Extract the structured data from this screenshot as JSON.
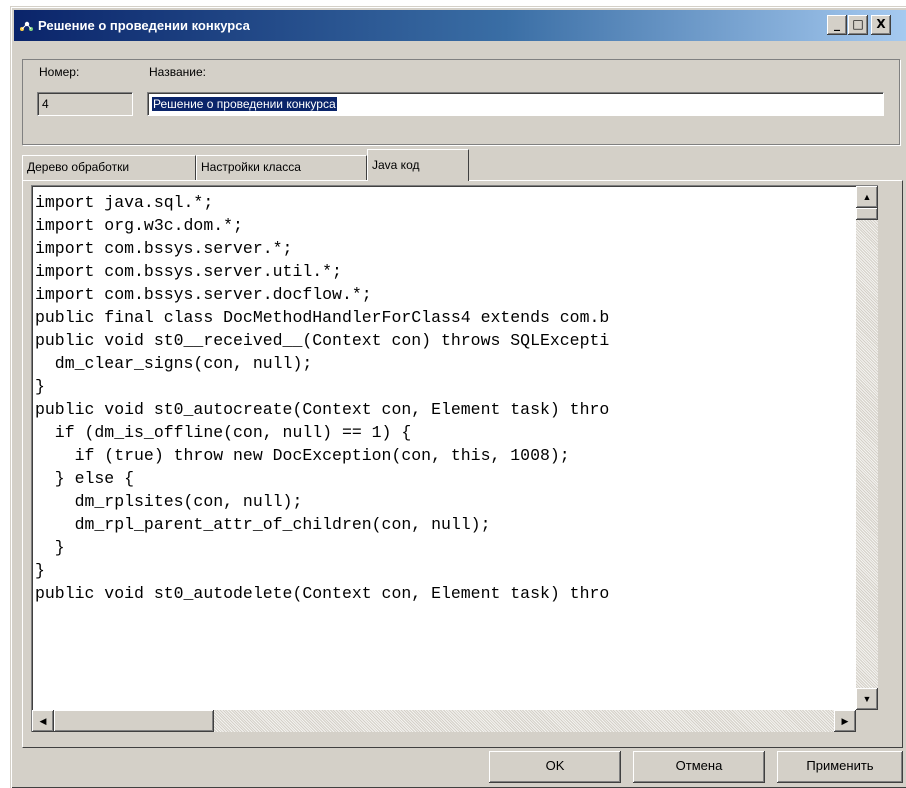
{
  "window": {
    "title": "Решение о проведении конкурса"
  },
  "title_buttons": {
    "minimize": "_",
    "maximize": "□",
    "close": "X"
  },
  "form": {
    "number_label": "Номер:",
    "number_value": "4",
    "name_label": "Название:",
    "name_value": "Решение о проведении конкурса"
  },
  "tabs": [
    {
      "label": "Дерево обработки",
      "active": false
    },
    {
      "label": "Настройки класса",
      "active": false
    },
    {
      "label": "Java код",
      "active": true
    }
  ],
  "code_lines": [
    "import java.sql.*;",
    "import org.w3c.dom.*;",
    "import com.bssys.server.*;",
    "import com.bssys.server.util.*;",
    "import com.bssys.server.docflow.*;",
    "public final class DocMethodHandlerForClass4 extends com.b",
    "public void st0__received__(Context con) throws SQLExcepti",
    "  dm_clear_signs(con, null);",
    "}",
    "public void st0_autocreate(Context con, Element task) thro",
    "  if (dm_is_offline(con, null) == 1) {",
    "    if (true) throw new DocException(con, this, 1008);",
    "  } else {",
    "    dm_rplsites(con, null);",
    "    dm_rpl_parent_attr_of_children(con, null);",
    "  }",
    "}",
    "public void st0_autodelete(Context con, Element task) thro"
  ],
  "buttons": {
    "ok": "OK",
    "cancel": "Отмена",
    "apply": "Применить"
  },
  "scroll_arrows": {
    "up": "▲",
    "down": "▼",
    "left": "◀",
    "right": "▶"
  }
}
